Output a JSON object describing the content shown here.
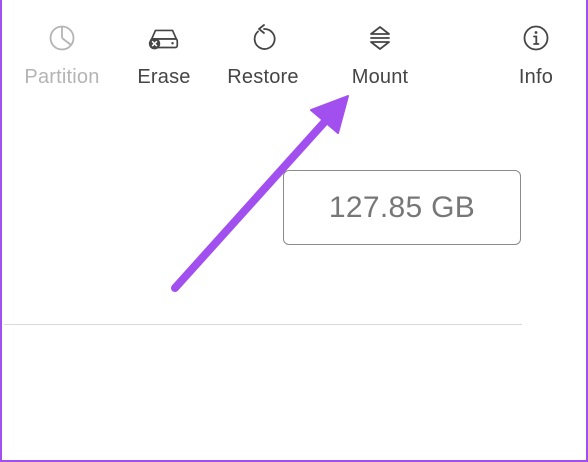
{
  "toolbar": {
    "items": [
      {
        "label": "Partition",
        "icon": "partition-icon",
        "enabled": false
      },
      {
        "label": "Erase",
        "icon": "erase-disk-icon",
        "enabled": true
      },
      {
        "label": "Restore",
        "icon": "restore-icon",
        "enabled": true
      },
      {
        "label": "Mount",
        "icon": "mount-icon",
        "enabled": true
      },
      {
        "label": "Info",
        "icon": "info-icon",
        "enabled": true
      }
    ]
  },
  "volume": {
    "capacity": "127.85 GB"
  },
  "annotation": {
    "arrow_color": "#a24ff0",
    "points_to": "Mount"
  },
  "colors": {
    "border": "#a24ff0",
    "label": "#454545",
    "label_disabled": "#b4b4b4"
  }
}
